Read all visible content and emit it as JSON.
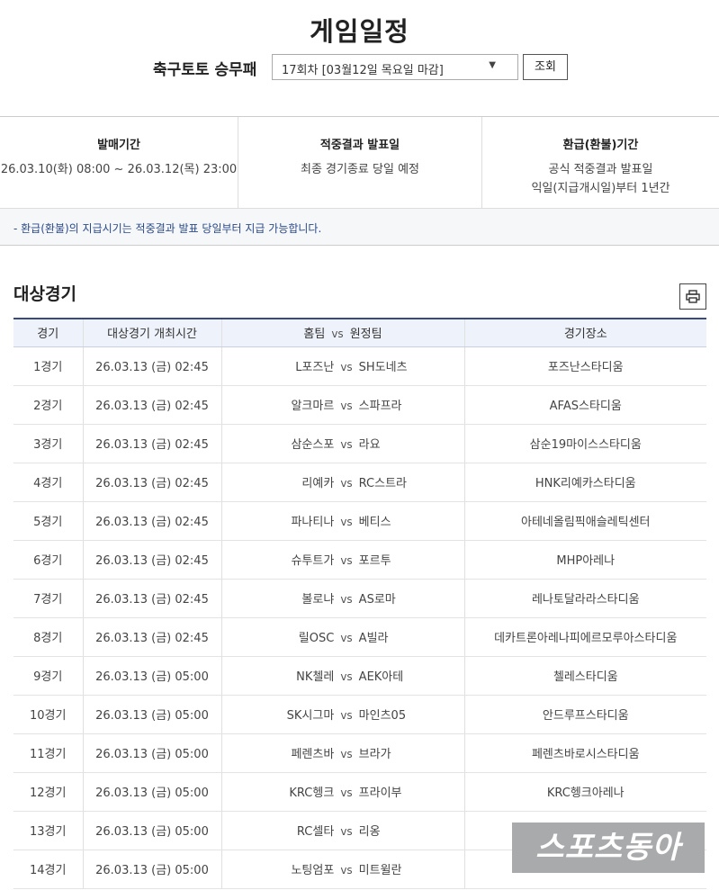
{
  "title": "게임일정",
  "game_label": "축구토토 승무패",
  "round_select": {
    "value": "17회차 [03월12일 목요일 마감]"
  },
  "query_label": "조회",
  "info": {
    "sale": {
      "head": "발매기간",
      "text": "26.03.10(화) 08:00 ~ 26.03.12(목) 23:00"
    },
    "result": {
      "head": "적중결과 발표일",
      "text": "최종 경기종료 당일 예정"
    },
    "refund": {
      "head": "환급(환불)기간",
      "line1": "공식 적중결과 발표일",
      "line2": "익일(지급개시일)부터 1년간"
    },
    "note": "- 환급(환불)의 지급시기는 적중결과 발표 당일부터 지급 가능합니다."
  },
  "section_title": "대상경기",
  "table": {
    "headers": {
      "match": "경기",
      "time": "대상경기 개최시간",
      "home": "홈팀",
      "vs": "vs",
      "away": "원정팀",
      "venue": "경기장소"
    },
    "vs_label": "vs",
    "rows": [
      {
        "no": "1경기",
        "time": "26.03.13 (금) 02:45",
        "home": "L포즈난",
        "away": "SH도네츠",
        "venue": "포즈난스타디움"
      },
      {
        "no": "2경기",
        "time": "26.03.13 (금) 02:45",
        "home": "알크마르",
        "away": "스파프라",
        "venue": "AFAS스타디움"
      },
      {
        "no": "3경기",
        "time": "26.03.13 (금) 02:45",
        "home": "삼순스포",
        "away": "라요",
        "venue": "삼순19마이스스타디움"
      },
      {
        "no": "4경기",
        "time": "26.03.13 (금) 02:45",
        "home": "리예카",
        "away": "RC스트라",
        "venue": "HNK리예카스타디움"
      },
      {
        "no": "5경기",
        "time": "26.03.13 (금) 02:45",
        "home": "파나티나",
        "away": "베티스",
        "venue": "아테네올림픽애슬레틱센터"
      },
      {
        "no": "6경기",
        "time": "26.03.13 (금) 02:45",
        "home": "슈투트가",
        "away": "포르투",
        "venue": "MHP아레나"
      },
      {
        "no": "7경기",
        "time": "26.03.13 (금) 02:45",
        "home": "볼로냐",
        "away": "AS로마",
        "venue": "레나토달라라스타디움"
      },
      {
        "no": "8경기",
        "time": "26.03.13 (금) 02:45",
        "home": "릴OSC",
        "away": "A빌라",
        "venue": "데카트론아레나피에르모루아스타디움"
      },
      {
        "no": "9경기",
        "time": "26.03.13 (금) 05:00",
        "home": "NK첼레",
        "away": "AEK아테",
        "venue": "첼레스타디움"
      },
      {
        "no": "10경기",
        "time": "26.03.13 (금) 05:00",
        "home": "SK시그마",
        "away": "마인츠05",
        "venue": "안드루프스타디움"
      },
      {
        "no": "11경기",
        "time": "26.03.13 (금) 05:00",
        "home": "페렌츠바",
        "away": "브라가",
        "venue": "페렌츠바로시스타디움"
      },
      {
        "no": "12경기",
        "time": "26.03.13 (금) 05:00",
        "home": "KRC헹크",
        "away": "프라이부",
        "venue": "KRC헹크아레나"
      },
      {
        "no": "13경기",
        "time": "26.03.13 (금) 05:00",
        "home": "RC셀타",
        "away": "리옹",
        "venue": ""
      },
      {
        "no": "14경기",
        "time": "26.03.13 (금) 05:00",
        "home": "노팅엄포",
        "away": "미트윌란",
        "venue": ""
      }
    ]
  },
  "watermark": "스포츠동아"
}
